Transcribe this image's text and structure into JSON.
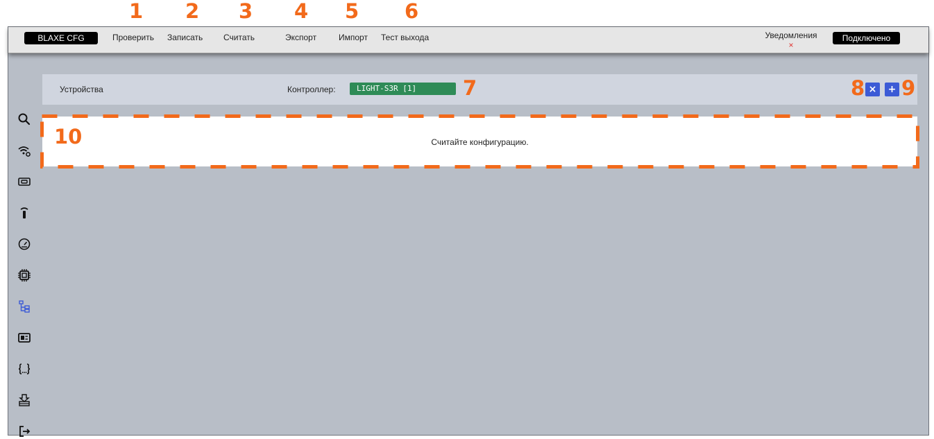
{
  "callouts": [
    "1",
    "2",
    "3",
    "4",
    "5",
    "6",
    "7",
    "8",
    "9",
    "10"
  ],
  "topbar": {
    "brand": "BLAXE CFG",
    "menu": [
      "Проверить",
      "Записать",
      "Считать",
      "Экспорт",
      "Импорт",
      "Тест выхода"
    ],
    "notifications_label": "Уведомления",
    "notifications_mark": "×",
    "status": "Подключено"
  },
  "devices": {
    "title": "Устройства",
    "controller_label": "Контроллер:",
    "controller_value": "LIGHT-S3R [1]",
    "remove_label": "×",
    "add_label": "+"
  },
  "config": {
    "message": "Считайте конфигурацию."
  },
  "sidebar": {
    "icons": [
      "search-icon",
      "wifi-settings-icon",
      "id-card-icon",
      "remote-icon",
      "gauge-icon",
      "chip-icon",
      "tree-structure-icon",
      "display-icon",
      "braces-icon",
      "upload-box-icon",
      "logout-icon"
    ],
    "active": "tree-structure-icon"
  },
  "colors": {
    "callout": "#f26a1b",
    "accent": "#3c5bd6",
    "controller": "#2e8b57",
    "background": "#b8bec7"
  }
}
